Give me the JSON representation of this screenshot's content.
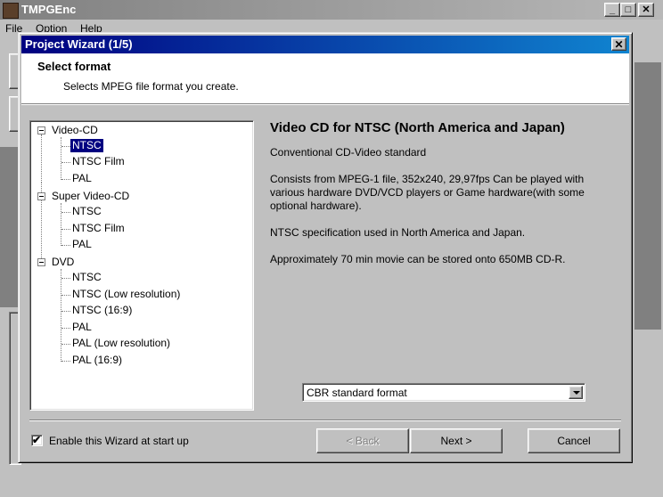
{
  "app": {
    "title": "TMPGEnc",
    "menu": [
      "File",
      "Option",
      "Help"
    ],
    "controls": {
      "minimize": "_",
      "maximize": "□",
      "close": "✕"
    }
  },
  "dialog": {
    "title": "Project Wizard (1/5)",
    "close": "✕",
    "header": {
      "title": "Select format",
      "subtitle": "Selects MPEG file format you create."
    },
    "tree": [
      {
        "label": "Video-CD",
        "expanded": true,
        "children": [
          {
            "label": "NTSC",
            "selected": true
          },
          {
            "label": "NTSC Film"
          },
          {
            "label": "PAL"
          }
        ]
      },
      {
        "label": "Super Video-CD",
        "expanded": true,
        "children": [
          {
            "label": "NTSC"
          },
          {
            "label": "NTSC Film"
          },
          {
            "label": "PAL"
          }
        ]
      },
      {
        "label": "DVD",
        "expanded": true,
        "children": [
          {
            "label": "NTSC"
          },
          {
            "label": "NTSC (Low resolution)"
          },
          {
            "label": "NTSC (16:9)"
          },
          {
            "label": "PAL"
          },
          {
            "label": "PAL (Low resolution)"
          },
          {
            "label": "PAL (16:9)"
          }
        ]
      }
    ],
    "description": {
      "title": "Video CD for NTSC (North America and Japan)",
      "paragraphs": [
        "Conventional CD-Video standard",
        "Consists from MPEG-1 file, 352x240, 29,97fps Can be played with various hardware DVD/VCD players or Game hardware(with some optional hardware).",
        "NTSC specification used in North America and Japan.",
        "Approximately 70 min movie can be stored onto 650MB CD-R."
      ]
    },
    "combo": {
      "value": "CBR   standard format"
    },
    "checkbox": {
      "label": "Enable this Wizard at start up",
      "checked": true,
      "mark": "✔"
    },
    "buttons": {
      "back": "< Back",
      "next": "Next >",
      "cancel": "Cancel"
    }
  }
}
